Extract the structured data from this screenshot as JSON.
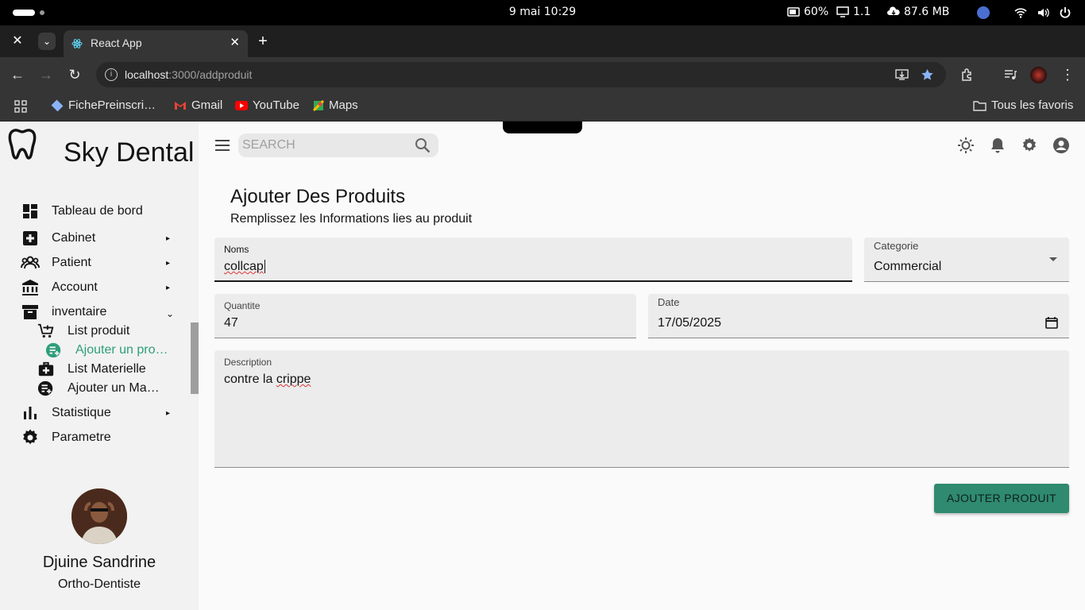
{
  "os": {
    "clock": "9 mai  10:29",
    "battery": "60%",
    "screens": "1.1",
    "memory": "87.6 MB"
  },
  "browser": {
    "tab_title": "React App",
    "url_host": "localhost",
    "url_path": ":3000/addproduit",
    "bookmarks": [
      "FichePreinscri…",
      "Gmail",
      "YouTube",
      "Maps"
    ],
    "all_bookmarks": "Tous les favoris"
  },
  "sidebar": {
    "brand": "Sky Dental",
    "items": [
      {
        "label": "Tableau de bord",
        "icon": "dashboard-icon"
      },
      {
        "label": "Cabinet",
        "icon": "medical-plus-icon"
      },
      {
        "label": "Patient",
        "icon": "group-icon"
      },
      {
        "label": "Account",
        "icon": "bank-icon"
      },
      {
        "label": "inventaire",
        "icon": "archive-icon"
      },
      {
        "label": "Statistique",
        "icon": "bar-chart-icon"
      },
      {
        "label": "Parametre",
        "icon": "gear-icon"
      }
    ],
    "sub_items": [
      {
        "label": "List produit",
        "icon": "cart-plus-icon"
      },
      {
        "label": "Ajouter un pro…",
        "icon": "playlist-add-icon"
      },
      {
        "label": "List Materielle",
        "icon": "medical-kit-icon"
      },
      {
        "label": "Ajouter un Ma…",
        "icon": "playlist-add-icon"
      }
    ],
    "user": {
      "name": "Djuine Sandrine",
      "role": "Ortho-Dentiste"
    },
    "accent_color": "#2e9e7a"
  },
  "topbar": {
    "search_placeholder": "SEARCH"
  },
  "main": {
    "title": "Ajouter Des Produits",
    "subtitle": "Remplissez les Informations lies au produit",
    "fields": {
      "noms": {
        "label": "Noms",
        "value": "collcap"
      },
      "categorie": {
        "label": "Categorie",
        "value": "Commercial"
      },
      "quantite": {
        "label": "Quantite",
        "value": "47"
      },
      "date": {
        "label": "Date",
        "value": "17/05/2025"
      },
      "description": {
        "label": "Description",
        "value": "contre la crippe"
      }
    },
    "submit_label": "AJOUTER PRODUIT",
    "button_color": "#2f8a6f"
  }
}
